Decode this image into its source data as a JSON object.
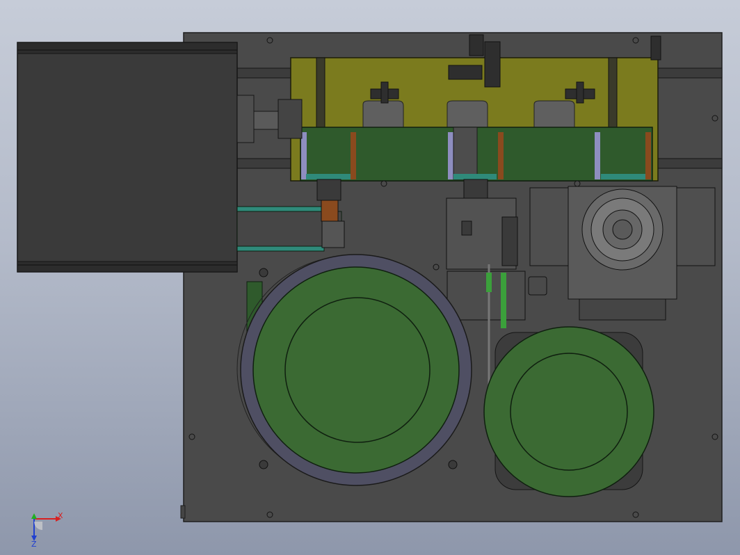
{
  "triad": {
    "x_label": "X",
    "y_label": "Y",
    "z_label": "Z",
    "x_color": "#d82020",
    "y_color": "#20b020",
    "z_color": "#2040d0"
  },
  "colors": {
    "base_plate": "#4a4a4a",
    "dark_panel": "#3a3a3a",
    "olive_frame": "#7b7b1e",
    "green_plate": "#2f5a2c",
    "bowl_green": "#3b6a33",
    "accent_orange": "#8a4a1e",
    "teal": "#2f8a7a"
  },
  "components": {
    "base_plate": "base-plate",
    "electrical_box": "electrical-box",
    "olive_frame": "gantry-frame",
    "green_plate": "gantry-carriage",
    "left_bowl": "left-feeder-bowl",
    "right_bowl": "right-feeder-bowl",
    "rotary_table": "rotary-table",
    "vertical_rod": "guide-rod"
  }
}
